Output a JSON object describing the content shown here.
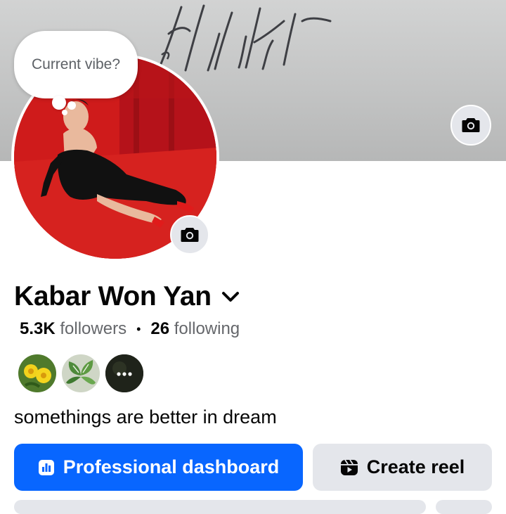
{
  "profile": {
    "name": "Kabar Won Yan",
    "followers_count": "5.3K",
    "followers_label": "followers",
    "following_count": "26",
    "following_label": "following",
    "bio": "somethings are better in dream"
  },
  "vibe_bubble": {
    "text": "Current vibe?"
  },
  "friends_preview": {
    "items": [
      {
        "image": "yellow-flower-photo"
      },
      {
        "image": "green-plant-photo"
      },
      {
        "image": "more-friends",
        "text": "•••"
      }
    ]
  },
  "actions": {
    "professional_dashboard": "Professional dashboard",
    "create_reel": "Create reel"
  },
  "colors": {
    "primary": "#0866ff",
    "secondary_button": "#e4e6eb",
    "text_primary": "#050505",
    "text_secondary": "#65676b",
    "avatar_background": "#cf1b1b"
  },
  "icons": [
    "camera-icon",
    "chevron-down-icon",
    "dashboard-icon",
    "reel-icon"
  ]
}
